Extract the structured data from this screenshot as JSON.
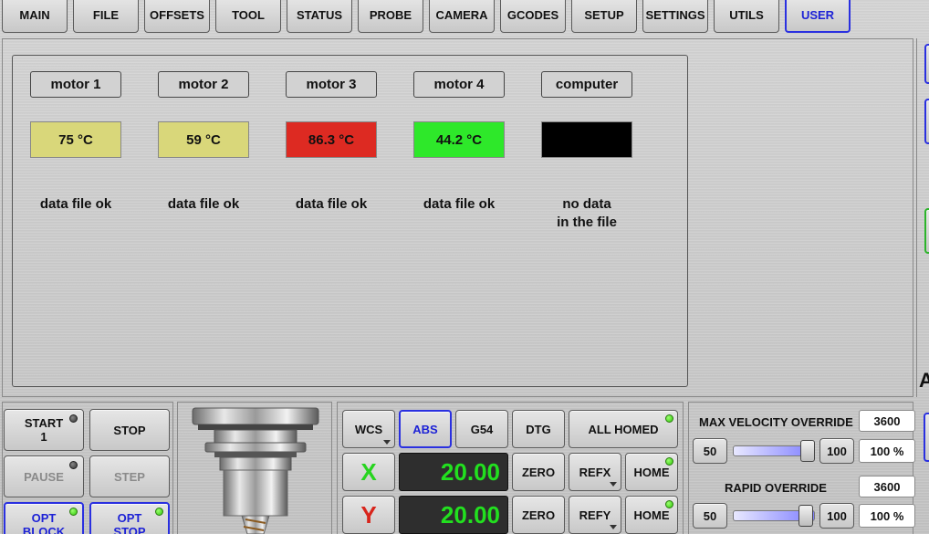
{
  "nav": {
    "tabs": [
      "MAIN",
      "FILE",
      "OFFSETS",
      "TOOL",
      "STATUS",
      "PROBE",
      "CAMERA",
      "GCODES",
      "SETUP",
      "SETTINGS",
      "UTILS",
      "USER"
    ],
    "active": "USER"
  },
  "motors": [
    {
      "name": "motor 1",
      "temp": "75 °C",
      "status": "data file ok",
      "color": "#d9d77a"
    },
    {
      "name": "motor 2",
      "temp": "59 °C",
      "status": "data file ok",
      "color": "#d9d77a"
    },
    {
      "name": "motor 3",
      "temp": "86.3 °C",
      "status": "data file ok",
      "color": "#dd2a22"
    },
    {
      "name": "motor 4",
      "temp": "44.2 °C",
      "status": "data file ok",
      "color": "#2ee82a"
    },
    {
      "name": "computer",
      "temp": "",
      "status": "no data\nin the file",
      "color": "#000000"
    }
  ],
  "program": {
    "start": "START\n1",
    "stop": "STOP",
    "pause": "PAUSE",
    "step": "STEP",
    "opt_block": "OPT\nBLOCK",
    "opt_stop": "OPT\nSTOP"
  },
  "dro": {
    "wcs": "WCS",
    "abs": "ABS",
    "g54": "G54",
    "dtg": "DTG",
    "all_homed": "ALL HOMED",
    "x": {
      "label": "X",
      "value": "20.00",
      "zero": "ZERO",
      "ref": "REFX",
      "home": "HOME"
    },
    "y": {
      "label": "Y",
      "value": "20.00",
      "zero": "ZERO",
      "ref": "REFY",
      "home": "HOME"
    },
    "x_color": "#27d41f",
    "y_color": "#d8251c"
  },
  "overrides": {
    "max_velocity_label": "MAX VELOCITY OVERRIDE",
    "max_velocity_value": "3600",
    "mv_min": "50",
    "mv_max": "100",
    "mv_percent": "100 %",
    "mv_fraction": 1.0,
    "rapid_label": "RAPID OVERRIDE",
    "rapid_value": "3600",
    "r_min": "50",
    "r_max": "100",
    "r_percent": "100 %",
    "r_fraction": 1.0
  },
  "right_edge_text": "A"
}
